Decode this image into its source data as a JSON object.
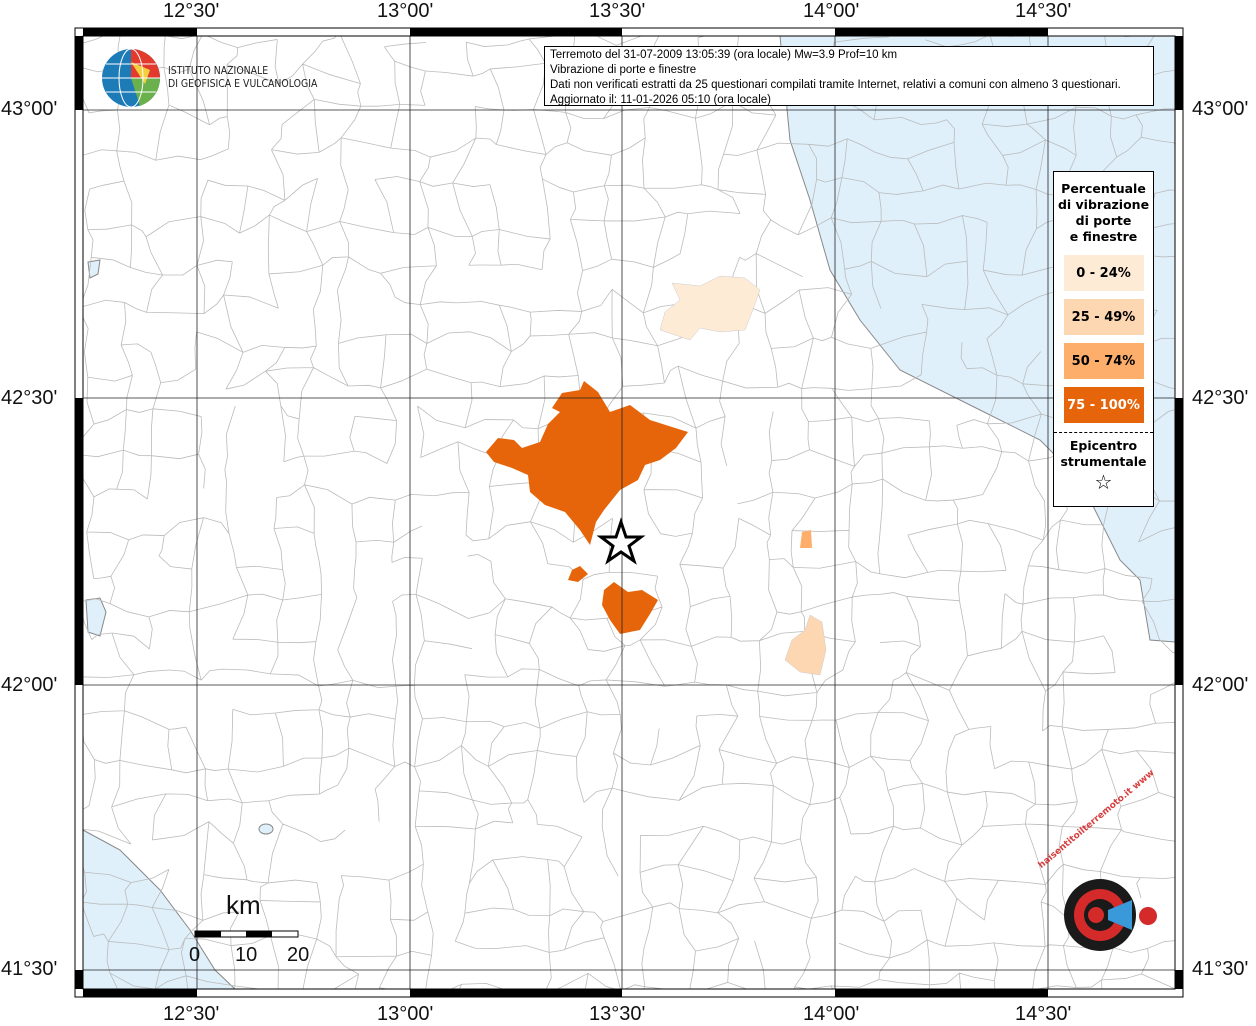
{
  "header": {
    "line1": "Terremoto del 31-07-2009 13:05:39 (ora locale) Mw=3.9 Prof=10 km",
    "line2": "Vibrazione di porte e finestre",
    "line3": "Dati non verificati estratti da 25 questionari compilati tramite Internet, relativi a comuni con almeno 3 questionari.",
    "line4": "Aggiornato il: 11-01-2026 05:10 (ora locale)"
  },
  "logo_ingv": {
    "line1": "ISTITUTO NAZIONALE",
    "line2": "DI GEOFISICA E VULCANOLOGIA"
  },
  "logo_hsit": "haisentitoilterremoto.it www",
  "axes": {
    "lon_labels": [
      "12°30'",
      "13°00'",
      "13°30'",
      "14°00'",
      "14°30'"
    ],
    "lat_labels": [
      "43°00'",
      "42°30'",
      "42°00'",
      "41°30'"
    ]
  },
  "legend": {
    "title_lines": [
      "Percentuale",
      "di vibrazione",
      "di porte",
      "e finestre"
    ],
    "classes": [
      {
        "label": "0 - 24%",
        "color": "#feebd6",
        "text": "#000"
      },
      {
        "label": "25 - 49%",
        "color": "#fdd7b1",
        "text": "#000"
      },
      {
        "label": "50 - 74%",
        "color": "#fdae6b",
        "text": "#000"
      },
      {
        "label": "75 - 100%",
        "color": "#e6650a",
        "text": "#fff"
      }
    ],
    "epicenter_lines": [
      "Epicentro",
      "strumentale"
    ],
    "epicenter_symbol": "☆"
  },
  "scale": {
    "unit": "km",
    "ticks": [
      "0",
      "10",
      "20"
    ]
  },
  "colors": {
    "sea": "#dff0fb",
    "land": "#ffffff",
    "borders": "#b5b5b5"
  }
}
